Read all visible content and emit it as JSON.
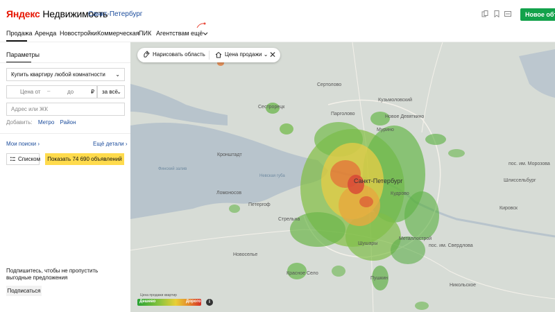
{
  "header": {
    "logo_brand": "Яндекс",
    "logo_product": "Недвижимость",
    "city": "Санкт-Петербург",
    "new_ad_button": "Новое объявление"
  },
  "nav": {
    "items": [
      "Продажа",
      "Аренда",
      "Новостройки",
      "Коммерческая",
      "ПИК",
      "Агентствам",
      "ещё"
    ],
    "active": "Продажа"
  },
  "panel": {
    "title": "Параметры",
    "type_select": "Купить квартиру любой комнатности",
    "price_from": "Цена от",
    "price_dash": "–",
    "price_to": "до",
    "currency": "₽",
    "price_unit": "за всё",
    "address_placeholder": "Адрес или ЖК",
    "add_label": "Добавить:",
    "add_metro": "Метро",
    "add_district": "Район",
    "my_searches": "Мои поиски",
    "more_details": "Ещё детали",
    "list_button": "Списком",
    "show_button": "Показать 74 690 объявлений",
    "subscribe_text": "Подпишитесь, чтобы не пропустить выгодные предложения",
    "subscribe_button": "Подписаться"
  },
  "map": {
    "toolbar": {
      "draw_area": "Нарисовать область",
      "sale_price": "Цена продажи"
    },
    "legend": {
      "title": "Цена продажи квартир",
      "cheap": "Дешево",
      "expensive": "Дорого"
    },
    "labels": {
      "sertolovo": "Сертолово",
      "kuzmolovsky": "Кузьмоловский",
      "sestroretsk": "Сестрорецк",
      "pargolovo": "Парголово",
      "murino": "Мурино",
      "novoe_devyatkino": "Новое Девяткино",
      "kronshtadt": "Кронштадт",
      "spb": "Санкт-Петербург",
      "lomonosov": "Ломоносов",
      "petergof": "Петергоф",
      "strelna": "Стрельна",
      "kudrovo": "Кудрово",
      "shushary": "Шушары",
      "metallostroy": "Металлострой",
      "sverdlova": "пос. им. Свердлова",
      "krasnoe_selo": "Красное Село",
      "pushkin": "Пушкин",
      "kirovsk": "Кировск",
      "shlisselburg": "Шлиссельбург",
      "morozova": "пос. им. Морозова",
      "nikolskoe": "Никольское",
      "novoselye": "Новоселье",
      "gulf": "Невская губа",
      "gulf2": "Финский залив"
    }
  },
  "colors": {
    "accent_green": "#13a24b",
    "show_button": "#ffdb4d",
    "link": "#1a4b9b"
  }
}
